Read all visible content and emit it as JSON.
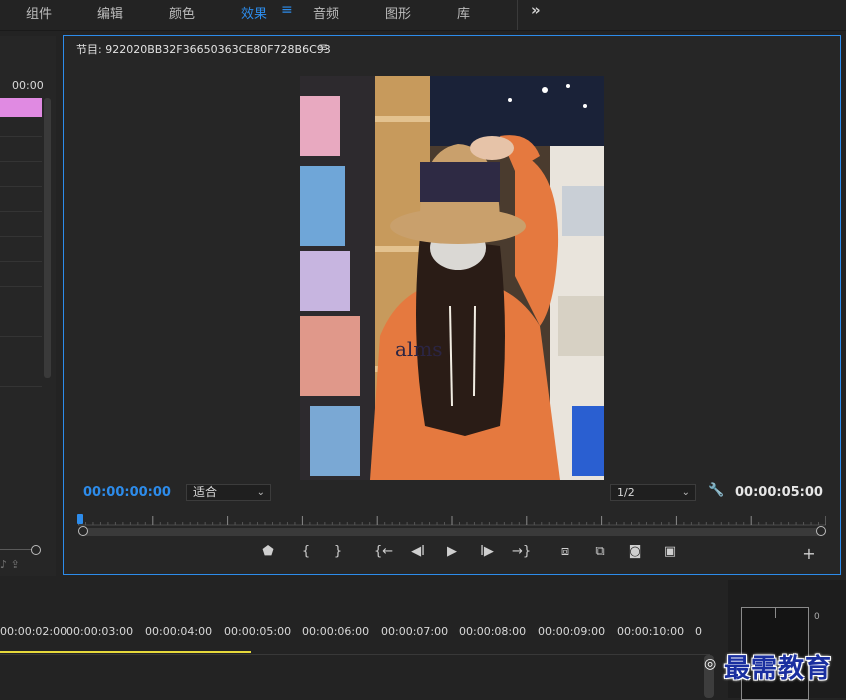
{
  "workspace_tabs": [
    {
      "label": "组件"
    },
    {
      "label": "编辑"
    },
    {
      "label": "颜色"
    },
    {
      "label": "效果"
    },
    {
      "label": "音频"
    },
    {
      "label": "图形"
    },
    {
      "label": "库"
    }
  ],
  "active_tab": "效果",
  "more_icon": "»",
  "left_panel": {
    "timecode": "00:00"
  },
  "program_monitor": {
    "title": "节目: 922020BB32F36650363CE80F728B6C93",
    "current_time": "00:00:00:00",
    "zoom_fit": "适合",
    "resolution": "1/2",
    "duration": "00:00:05:00",
    "transport_icons": [
      "marker-icon",
      "mark-in-icon",
      "mark-out-icon",
      "go-to-in-icon",
      "step-back-icon",
      "play-icon",
      "step-forward-icon",
      "go-to-out-icon",
      "lift-icon",
      "extract-icon",
      "export-frame-icon",
      "comparison-view-icon",
      "add-button-icon"
    ]
  },
  "timeline": {
    "ticks": [
      "00:00:02:00",
      "00:00:03:00",
      "00:00:04:00",
      "00:00:05:00",
      "00:00:06:00",
      "00:00:07:00",
      "00:00:08:00",
      "00:00:09:00",
      "00:00:10:00",
      "0"
    ]
  },
  "audio_meter": {
    "label": "0"
  },
  "watermark": "最需教育",
  "colors": {
    "accent": "#2d8ceb",
    "clip_pink": "#e08ae2",
    "work_area": "#e6d93b"
  }
}
